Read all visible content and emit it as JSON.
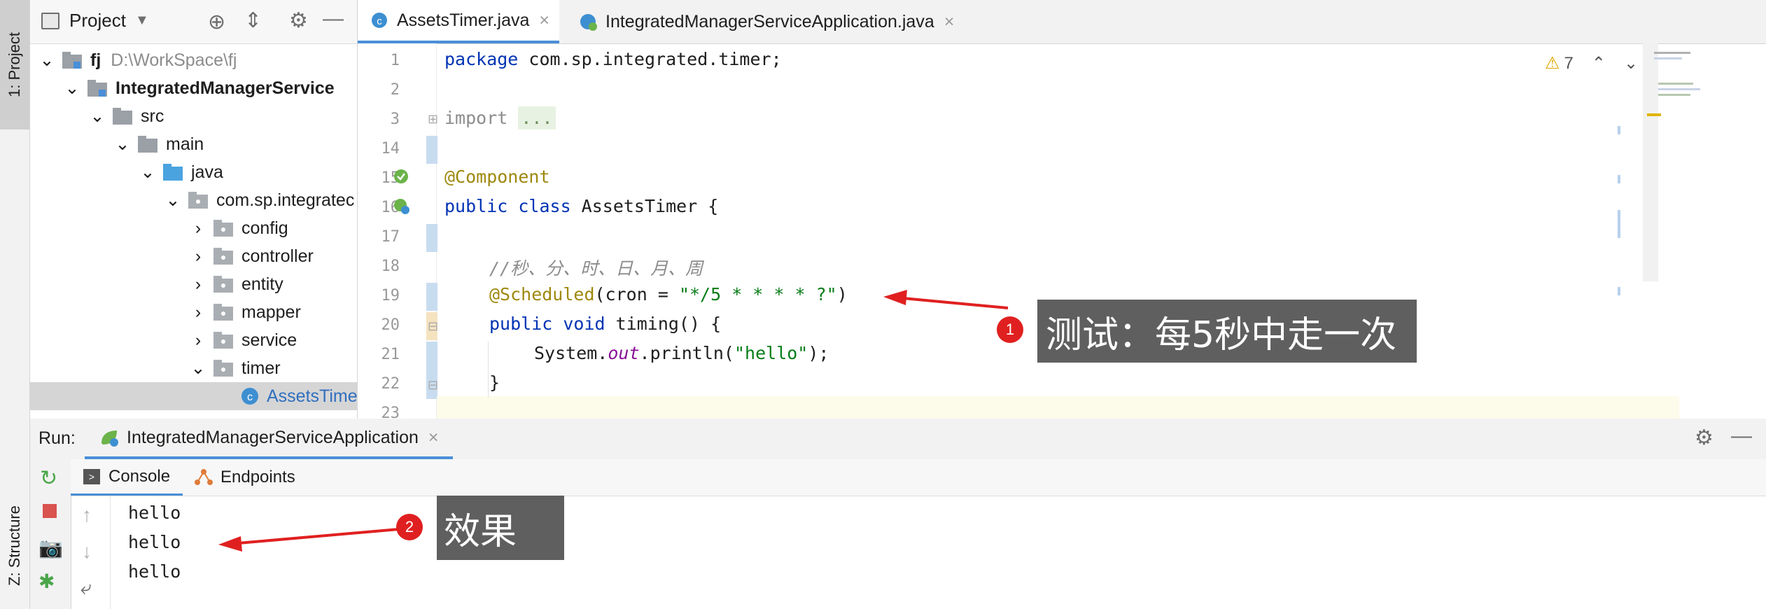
{
  "tool_strip": {
    "project_label": "1: Project",
    "structure_label": "Z: Structure"
  },
  "project": {
    "header_title": "Project",
    "tree": [
      {
        "label": "fj",
        "hint": "D:\\WorkSpace\\fj"
      },
      {
        "label": "IntegratedManagerService"
      },
      {
        "label": "src"
      },
      {
        "label": "main"
      },
      {
        "label": "java"
      },
      {
        "label": "com.sp.integratec"
      },
      {
        "label": "config"
      },
      {
        "label": "controller"
      },
      {
        "label": "entity"
      },
      {
        "label": "mapper"
      },
      {
        "label": "service"
      },
      {
        "label": "timer"
      },
      {
        "label": "AssetsTime"
      }
    ]
  },
  "editor": {
    "tabs": [
      {
        "label": "AssetsTimer.java"
      },
      {
        "label": "IntegratedManagerServiceApplication.java"
      }
    ],
    "warning_count": "7",
    "lines": [
      {
        "num": "1"
      },
      {
        "num": "2"
      },
      {
        "num": "3"
      },
      {
        "num": "14"
      },
      {
        "num": "15"
      },
      {
        "num": "16"
      },
      {
        "num": "17"
      },
      {
        "num": "18"
      },
      {
        "num": "19"
      },
      {
        "num": "20"
      },
      {
        "num": "21"
      },
      {
        "num": "22"
      },
      {
        "num": "23"
      }
    ],
    "code": {
      "l1_kw": "package",
      "l1_rest": " com.sp.integrated.timer;",
      "l3_kw": "import",
      "l3_fold": "...",
      "l15_ann": "@Component",
      "l16_kw": "public class",
      "l16_rest": " AssetsTimer {",
      "l18_comment": "//秒、分、时、日、月、周",
      "l19_ann": "@Scheduled",
      "l19_mid": "(cron = ",
      "l19_str": "\"*/5 * * * * ?\"",
      "l19_end": ")",
      "l20_kw": "public void",
      "l20_rest": " timing() {",
      "l21_a": "System.",
      "l21_field": "out",
      "l21_b": ".println(",
      "l21_str": "\"hello\"",
      "l21_c": ");",
      "l22": "}"
    }
  },
  "run": {
    "label": "Run:",
    "config_tab": "IntegratedManagerServiceApplication",
    "tabs": [
      {
        "label": "Console"
      },
      {
        "label": "Endpoints"
      }
    ],
    "console_lines": [
      "hello",
      "hello",
      "hello"
    ]
  },
  "callouts": [
    {
      "badge": "1",
      "text": "测试：每5秒中走一次"
    },
    {
      "badge": "2",
      "text": "效果"
    }
  ]
}
